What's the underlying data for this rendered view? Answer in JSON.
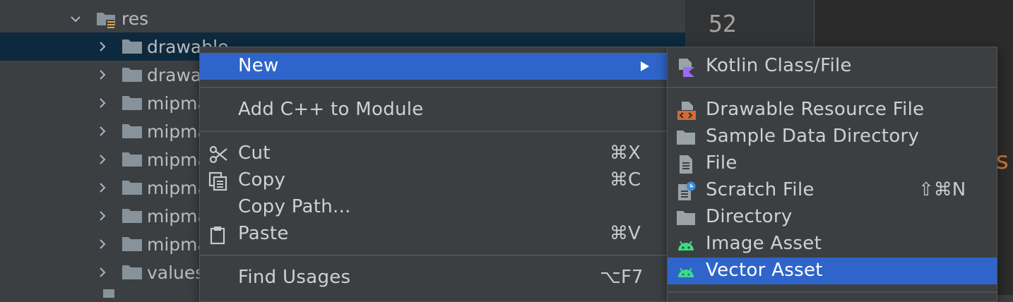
{
  "tree": {
    "rows": [
      {
        "label": "res",
        "expanded": true
      },
      {
        "label": "drawable"
      },
      {
        "label": "drawa"
      },
      {
        "label": "mipma"
      },
      {
        "label": "mipma"
      },
      {
        "label": "mipma"
      },
      {
        "label": "mipma"
      },
      {
        "label": "mipma"
      },
      {
        "label": "mipma"
      },
      {
        "label": "values"
      }
    ]
  },
  "editor": {
    "line_number": "52",
    "partial_text": "s"
  },
  "context_menu": {
    "new_label": "New",
    "add_cpp_label": "Add C++ to Module",
    "cut_label": "Cut",
    "cut_shortcut": "⌘X",
    "copy_label": "Copy",
    "copy_shortcut": "⌘C",
    "copy_path_label": "Copy Path...",
    "paste_label": "Paste",
    "paste_shortcut": "⌘V",
    "find_usages_label": "Find Usages",
    "find_usages_shortcut": "⌥F7"
  },
  "submenu": {
    "kotlin_label": "Kotlin Class/File",
    "drawable_label": "Drawable Resource File",
    "sample_data_label": "Sample Data Directory",
    "file_label": "File",
    "scratch_label": "Scratch File",
    "scratch_shortcut": "⇧⌘N",
    "directory_label": "Directory",
    "image_asset_label": "Image Asset",
    "vector_asset_label": "Vector Asset"
  },
  "colors": {
    "highlight": "#2f65ca",
    "selection": "#0d293e",
    "android_green": "#3ddc84",
    "kotlin_purple": "#9b6cf2",
    "drawable_orange": "#d26b3a"
  }
}
